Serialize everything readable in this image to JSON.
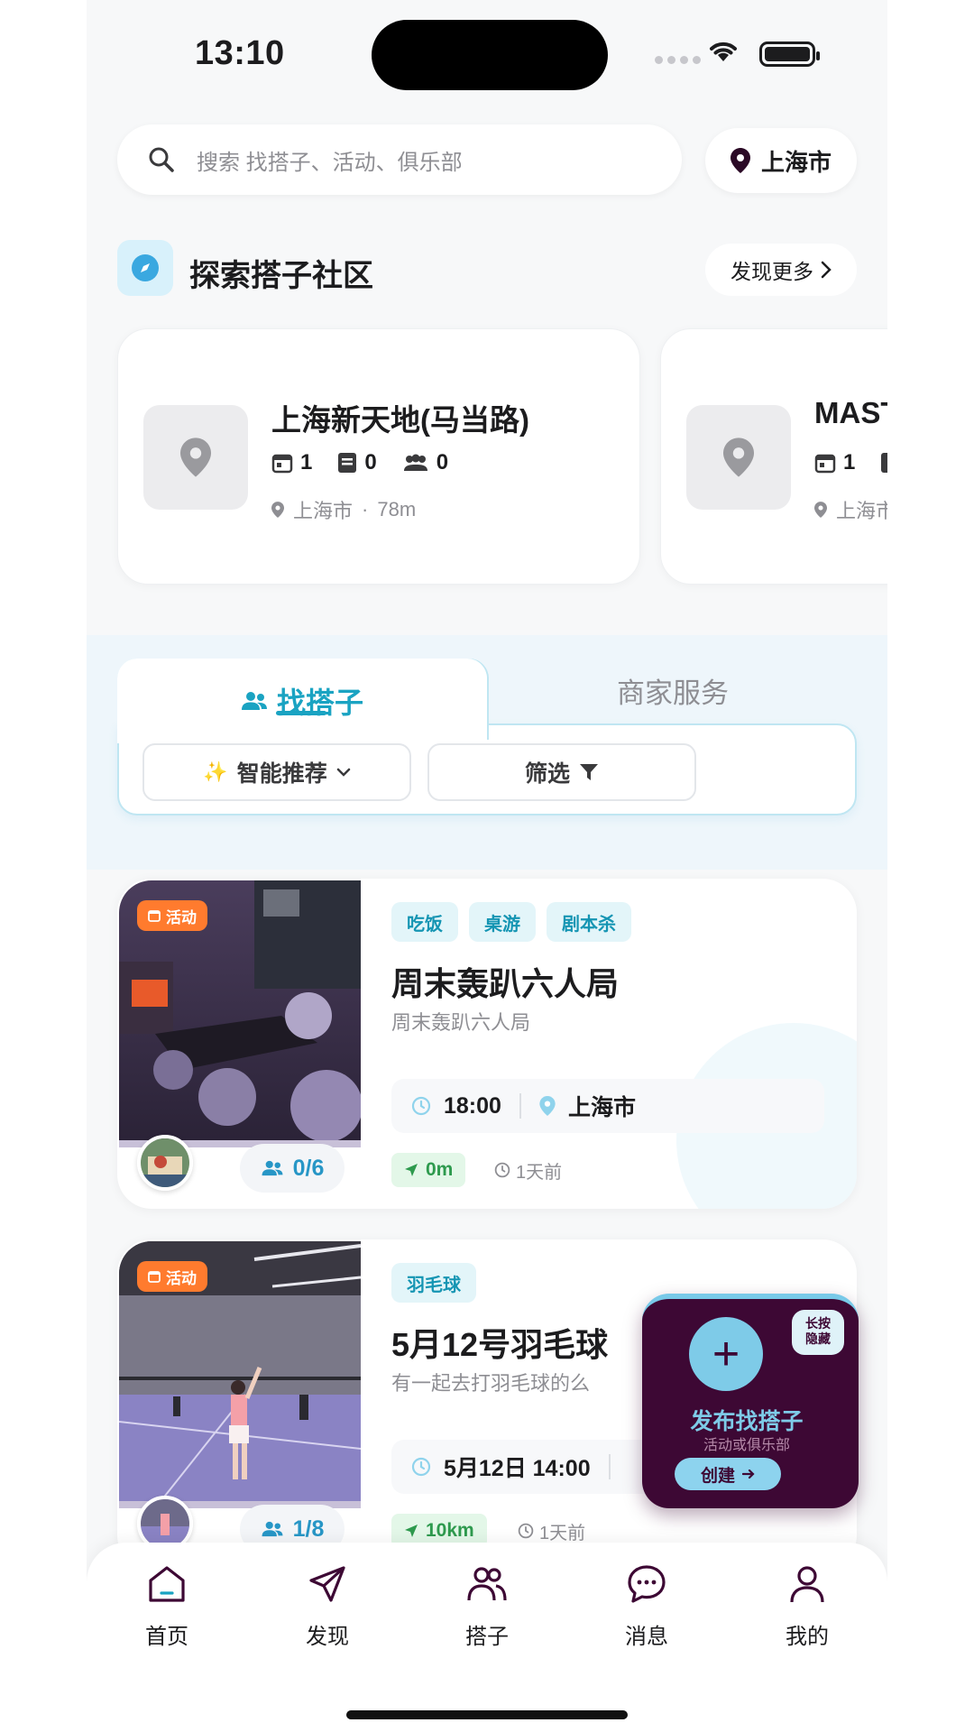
{
  "status_bar": {
    "time": "13:10"
  },
  "search": {
    "placeholder": "搜索 找搭子、活动、俱乐部",
    "icon": "search-icon"
  },
  "location": {
    "city": "上海市",
    "icon": "location-pin-icon"
  },
  "explore": {
    "title": "探索搭子社区",
    "icon": "compass-icon",
    "more_label": "发现更多"
  },
  "venues": [
    {
      "name": "上海新天地(马当路)",
      "events": "1",
      "posts": "0",
      "members": "0",
      "city": "上海市",
      "distance": "78m",
      "separator": "·"
    },
    {
      "name": "MAST",
      "events": "1",
      "city": "上海市"
    }
  ],
  "tabs": {
    "active": "找搭子",
    "other": "商家服务",
    "sort_label": "智能推荐",
    "filter_label": "筛选"
  },
  "posts": [
    {
      "badge": "活动",
      "tags": [
        "吃饭",
        "桌游",
        "剧本杀"
      ],
      "title": "周末轰趴六人局",
      "desc": "周末轰趴六人局",
      "time": "18:00",
      "place": "上海市",
      "count": "0/6",
      "distance": "0m",
      "ago": "1天前"
    },
    {
      "badge": "活动",
      "tags": [
        "羽毛球"
      ],
      "title": "5月12号羽毛球",
      "desc": "有一起去打羽毛球的么",
      "time": "5月12日 14:00",
      "count": "1/8",
      "distance": "10km",
      "ago": "1天前"
    }
  ],
  "fab": {
    "hold_line1": "长按",
    "hold_line2": "隐藏",
    "title": "发布找搭子",
    "subtitle": "活动或俱乐部",
    "create_label": "创建"
  },
  "nav": [
    {
      "label": "首页",
      "icon": "home-icon"
    },
    {
      "label": "发现",
      "icon": "send-icon"
    },
    {
      "label": "搭子",
      "icon": "users-icon"
    },
    {
      "label": "消息",
      "icon": "message-icon"
    },
    {
      "label": "我的",
      "icon": "user-icon"
    }
  ],
  "colors": {
    "accent": "#1aa3c2",
    "fab_bg": "#3d0834",
    "badge": "#ff7b2e",
    "distance": "#2e9a4e"
  }
}
